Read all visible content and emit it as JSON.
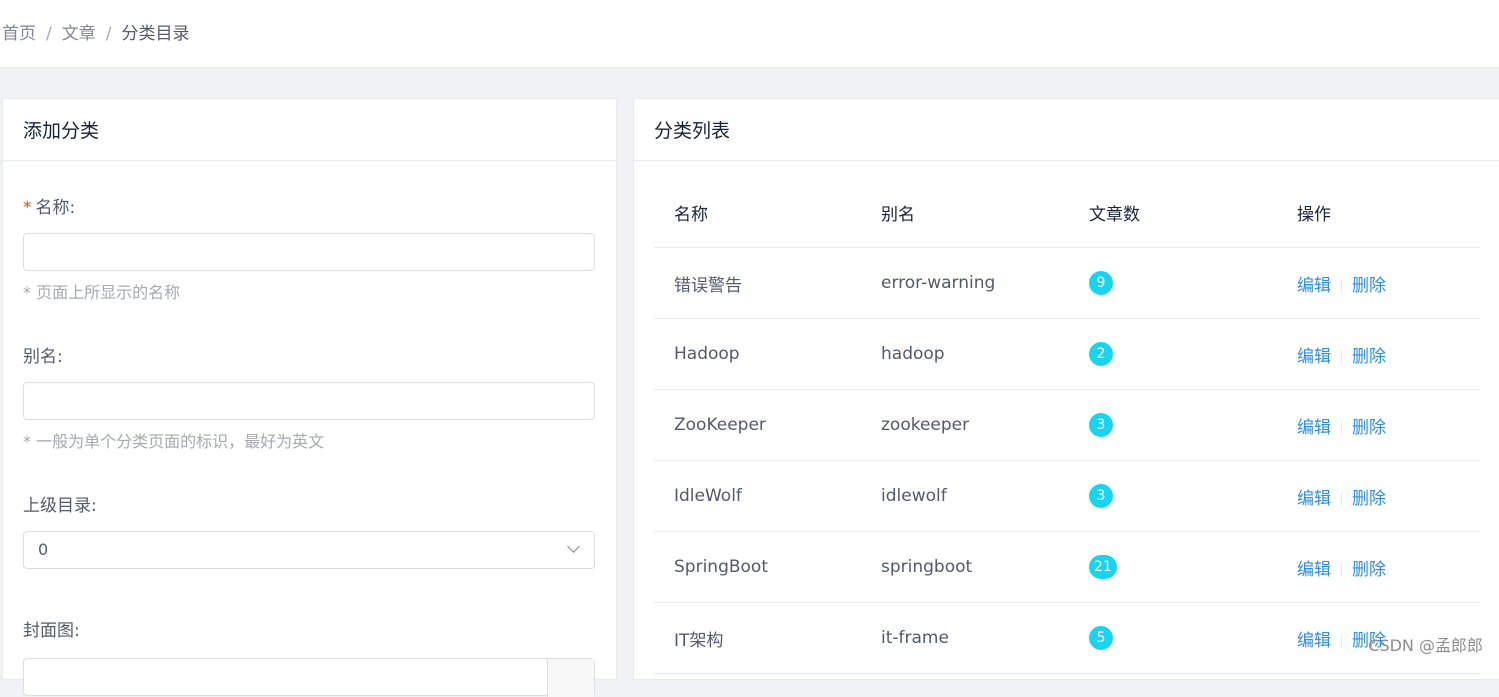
{
  "breadcrumb": {
    "home": "首页",
    "articles": "文章",
    "current": "分类目录",
    "separator": "/"
  },
  "add_panel": {
    "title": "添加分类",
    "name_label": "名称:",
    "required_mark": "*",
    "name_value": "",
    "name_hint": "* 页面上所显示的名称",
    "alias_label": "别名:",
    "alias_value": "",
    "alias_hint": "* 一般为单个分类页面的标识，最好为英文",
    "parent_label": "上级目录:",
    "parent_value": "0",
    "cover_label": "封面图:"
  },
  "list_panel": {
    "title": "分类列表",
    "columns": [
      "名称",
      "别名",
      "文章数",
      "操作"
    ],
    "edit_label": "编辑",
    "delete_label": "删除",
    "rows": [
      {
        "name": "错误警告",
        "alias": "error-warning",
        "count": "9"
      },
      {
        "name": "Hadoop",
        "alias": "hadoop",
        "count": "2"
      },
      {
        "name": "ZooKeeper",
        "alias": "zookeeper",
        "count": "3"
      },
      {
        "name": "IdleWolf",
        "alias": "idlewolf",
        "count": "3"
      },
      {
        "name": "SpringBoot",
        "alias": "springboot",
        "count": "21"
      },
      {
        "name": "IT架构",
        "alias": "it-frame",
        "count": "5"
      }
    ]
  },
  "watermark": "CSDN @孟郎郎",
  "colors": {
    "badge": "#19d4f0",
    "link": "#2d8cf0",
    "required": "#ed4014"
  }
}
